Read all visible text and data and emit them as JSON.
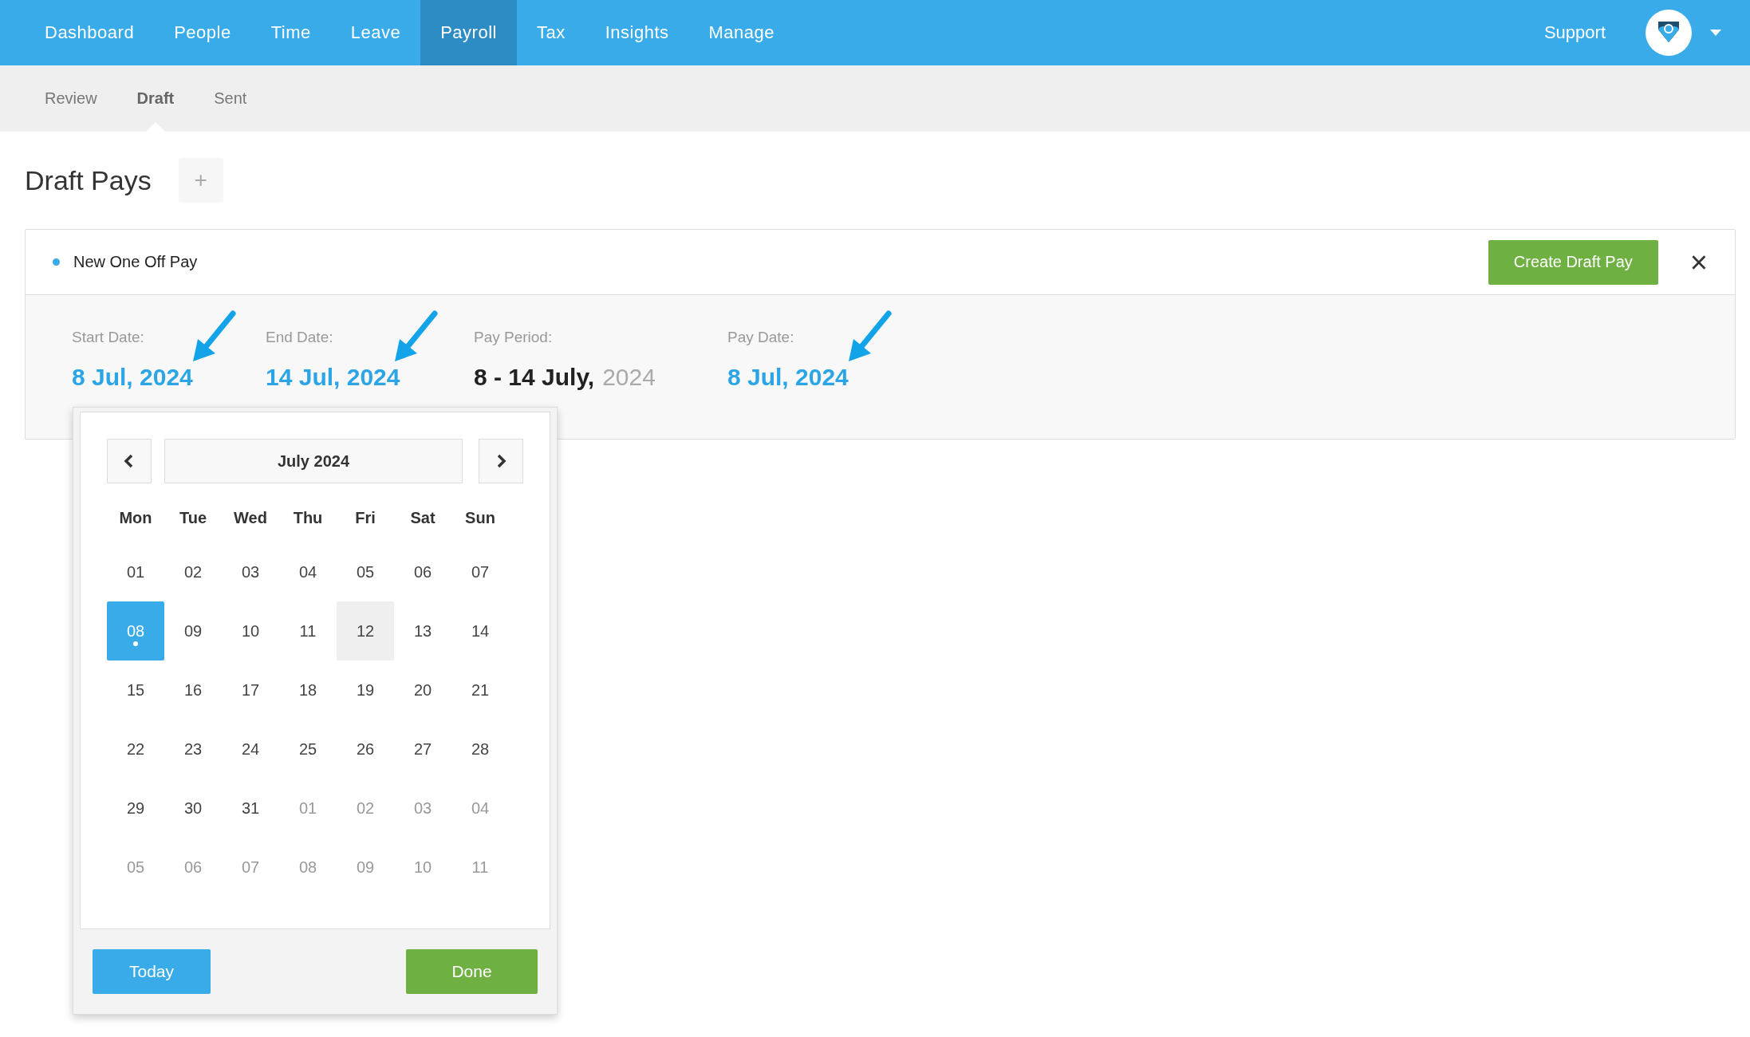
{
  "top_nav": {
    "items": [
      {
        "label": "Dashboard",
        "selected": false
      },
      {
        "label": "People",
        "selected": false
      },
      {
        "label": "Time",
        "selected": false
      },
      {
        "label": "Leave",
        "selected": false
      },
      {
        "label": "Payroll",
        "selected": true
      },
      {
        "label": "Tax",
        "selected": false
      },
      {
        "label": "Insights",
        "selected": false
      },
      {
        "label": "Manage",
        "selected": false
      }
    ],
    "support": "Support"
  },
  "sub_nav": [
    {
      "label": "Review",
      "selected": false
    },
    {
      "label": "Draft",
      "selected": true
    },
    {
      "label": "Sent",
      "selected": false
    }
  ],
  "page_title": "Draft Pays",
  "add_button": "+",
  "card": {
    "title": "New One Off Pay",
    "create_button": "Create Draft Pay",
    "close_button": "×",
    "fields": [
      {
        "label": "Start Date:",
        "kind": "link",
        "value": "8 Jul, 2024",
        "arrow": true
      },
      {
        "label": "End Date:",
        "kind": "link",
        "value": "14 Jul, 2024",
        "arrow": true
      },
      {
        "label": "Pay Period:",
        "kind": "period",
        "value": "8 - 14 July,",
        "year": "2024",
        "arrow": false
      },
      {
        "label": "Pay Date:",
        "kind": "link",
        "value": "8 Jul, 2024",
        "arrow": true
      }
    ]
  },
  "calendar": {
    "month": "July 2024",
    "weekdays": [
      "Mon",
      "Tue",
      "Wed",
      "Thu",
      "Fri",
      "Sat",
      "Sun"
    ],
    "weeks": [
      [
        {
          "day": "01",
          "muted": false,
          "selected": false,
          "hovered": false
        },
        {
          "day": "02",
          "muted": false,
          "selected": false,
          "hovered": false
        },
        {
          "day": "03",
          "muted": false,
          "selected": false,
          "hovered": false
        },
        {
          "day": "04",
          "muted": false,
          "selected": false,
          "hovered": false
        },
        {
          "day": "05",
          "muted": false,
          "selected": false,
          "hovered": false
        },
        {
          "day": "06",
          "muted": false,
          "selected": false,
          "hovered": false
        },
        {
          "day": "07",
          "muted": false,
          "selected": false,
          "hovered": false
        }
      ],
      [
        {
          "day": "08",
          "muted": false,
          "selected": true,
          "hovered": false
        },
        {
          "day": "09",
          "muted": false,
          "selected": false,
          "hovered": false
        },
        {
          "day": "10",
          "muted": false,
          "selected": false,
          "hovered": false
        },
        {
          "day": "11",
          "muted": false,
          "selected": false,
          "hovered": false
        },
        {
          "day": "12",
          "muted": false,
          "selected": false,
          "hovered": true
        },
        {
          "day": "13",
          "muted": false,
          "selected": false,
          "hovered": false
        },
        {
          "day": "14",
          "muted": false,
          "selected": false,
          "hovered": false
        }
      ],
      [
        {
          "day": "15",
          "muted": false,
          "selected": false,
          "hovered": false
        },
        {
          "day": "16",
          "muted": false,
          "selected": false,
          "hovered": false
        },
        {
          "day": "17",
          "muted": false,
          "selected": false,
          "hovered": false
        },
        {
          "day": "18",
          "muted": false,
          "selected": false,
          "hovered": false
        },
        {
          "day": "19",
          "muted": false,
          "selected": false,
          "hovered": false
        },
        {
          "day": "20",
          "muted": false,
          "selected": false,
          "hovered": false
        },
        {
          "day": "21",
          "muted": false,
          "selected": false,
          "hovered": false
        }
      ],
      [
        {
          "day": "22",
          "muted": false,
          "selected": false,
          "hovered": false
        },
        {
          "day": "23",
          "muted": false,
          "selected": false,
          "hovered": false
        },
        {
          "day": "24",
          "muted": false,
          "selected": false,
          "hovered": false
        },
        {
          "day": "25",
          "muted": false,
          "selected": false,
          "hovered": false
        },
        {
          "day": "26",
          "muted": false,
          "selected": false,
          "hovered": false
        },
        {
          "day": "27",
          "muted": false,
          "selected": false,
          "hovered": false
        },
        {
          "day": "28",
          "muted": false,
          "selected": false,
          "hovered": false
        }
      ],
      [
        {
          "day": "29",
          "muted": false,
          "selected": false,
          "hovered": false
        },
        {
          "day": "30",
          "muted": false,
          "selected": false,
          "hovered": false
        },
        {
          "day": "31",
          "muted": false,
          "selected": false,
          "hovered": false
        },
        {
          "day": "01",
          "muted": true,
          "selected": false,
          "hovered": false
        },
        {
          "day": "02",
          "muted": true,
          "selected": false,
          "hovered": false
        },
        {
          "day": "03",
          "muted": true,
          "selected": false,
          "hovered": false
        },
        {
          "day": "04",
          "muted": true,
          "selected": false,
          "hovered": false
        }
      ],
      [
        {
          "day": "05",
          "muted": true,
          "selected": false,
          "hovered": false
        },
        {
          "day": "06",
          "muted": true,
          "selected": false,
          "hovered": false
        },
        {
          "day": "07",
          "muted": true,
          "selected": false,
          "hovered": false
        },
        {
          "day": "08",
          "muted": true,
          "selected": false,
          "hovered": false
        },
        {
          "day": "09",
          "muted": true,
          "selected": false,
          "hovered": false
        },
        {
          "day": "10",
          "muted": true,
          "selected": false,
          "hovered": false
        },
        {
          "day": "11",
          "muted": true,
          "selected": false,
          "hovered": false
        }
      ]
    ],
    "today_button": "Today",
    "done_button": "Done"
  }
}
